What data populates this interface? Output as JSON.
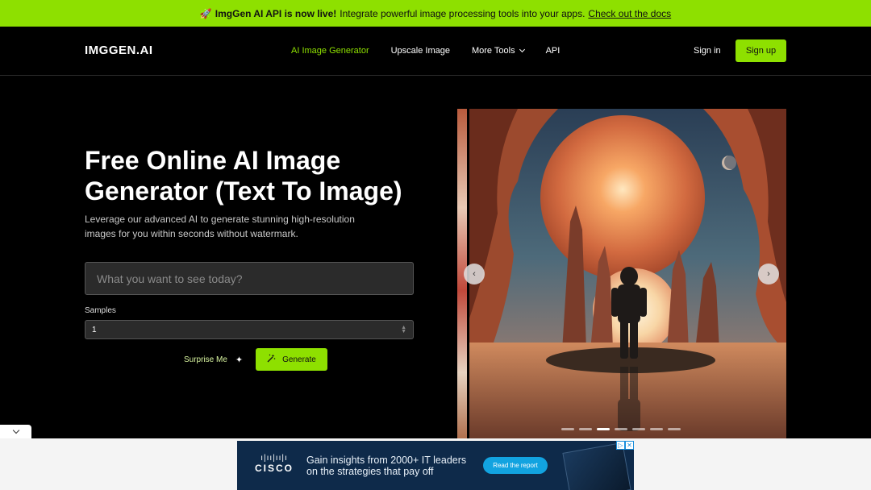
{
  "announcement": {
    "icon": "🚀",
    "bold": "ImgGen AI API is now live!",
    "text": "Integrate powerful image processing tools into your apps.",
    "link": "Check out the docs",
    "color": "#8ee000"
  },
  "header": {
    "logo": "IMGGEN.AI",
    "nav": [
      {
        "label": "AI Image Generator",
        "active": true
      },
      {
        "label": "Upscale Image"
      },
      {
        "label": "More Tools",
        "dropdown": true
      },
      {
        "label": "API"
      }
    ],
    "signin": "Sign in",
    "signup": "Sign up"
  },
  "hero": {
    "title": "Free Online AI Image Generator (Text To Image)",
    "subtitle": "Leverage our advanced AI to generate stunning high-resolution images for you within seconds without watermark.",
    "prompt_placeholder": "What you want to see today?",
    "samples_label": "Samples",
    "samples_value": "1",
    "surprise": "Surprise Me",
    "generate": "Generate"
  },
  "carousel": {
    "prev_icon": "chevron-left",
    "next_icon": "chevron-right",
    "dot_count": 7,
    "active_index": 2
  },
  "ad": {
    "brand": "CISCO",
    "text": "Gain insights from 2000+ IT leaders on the strategies that pay off",
    "button": "Read the report"
  }
}
